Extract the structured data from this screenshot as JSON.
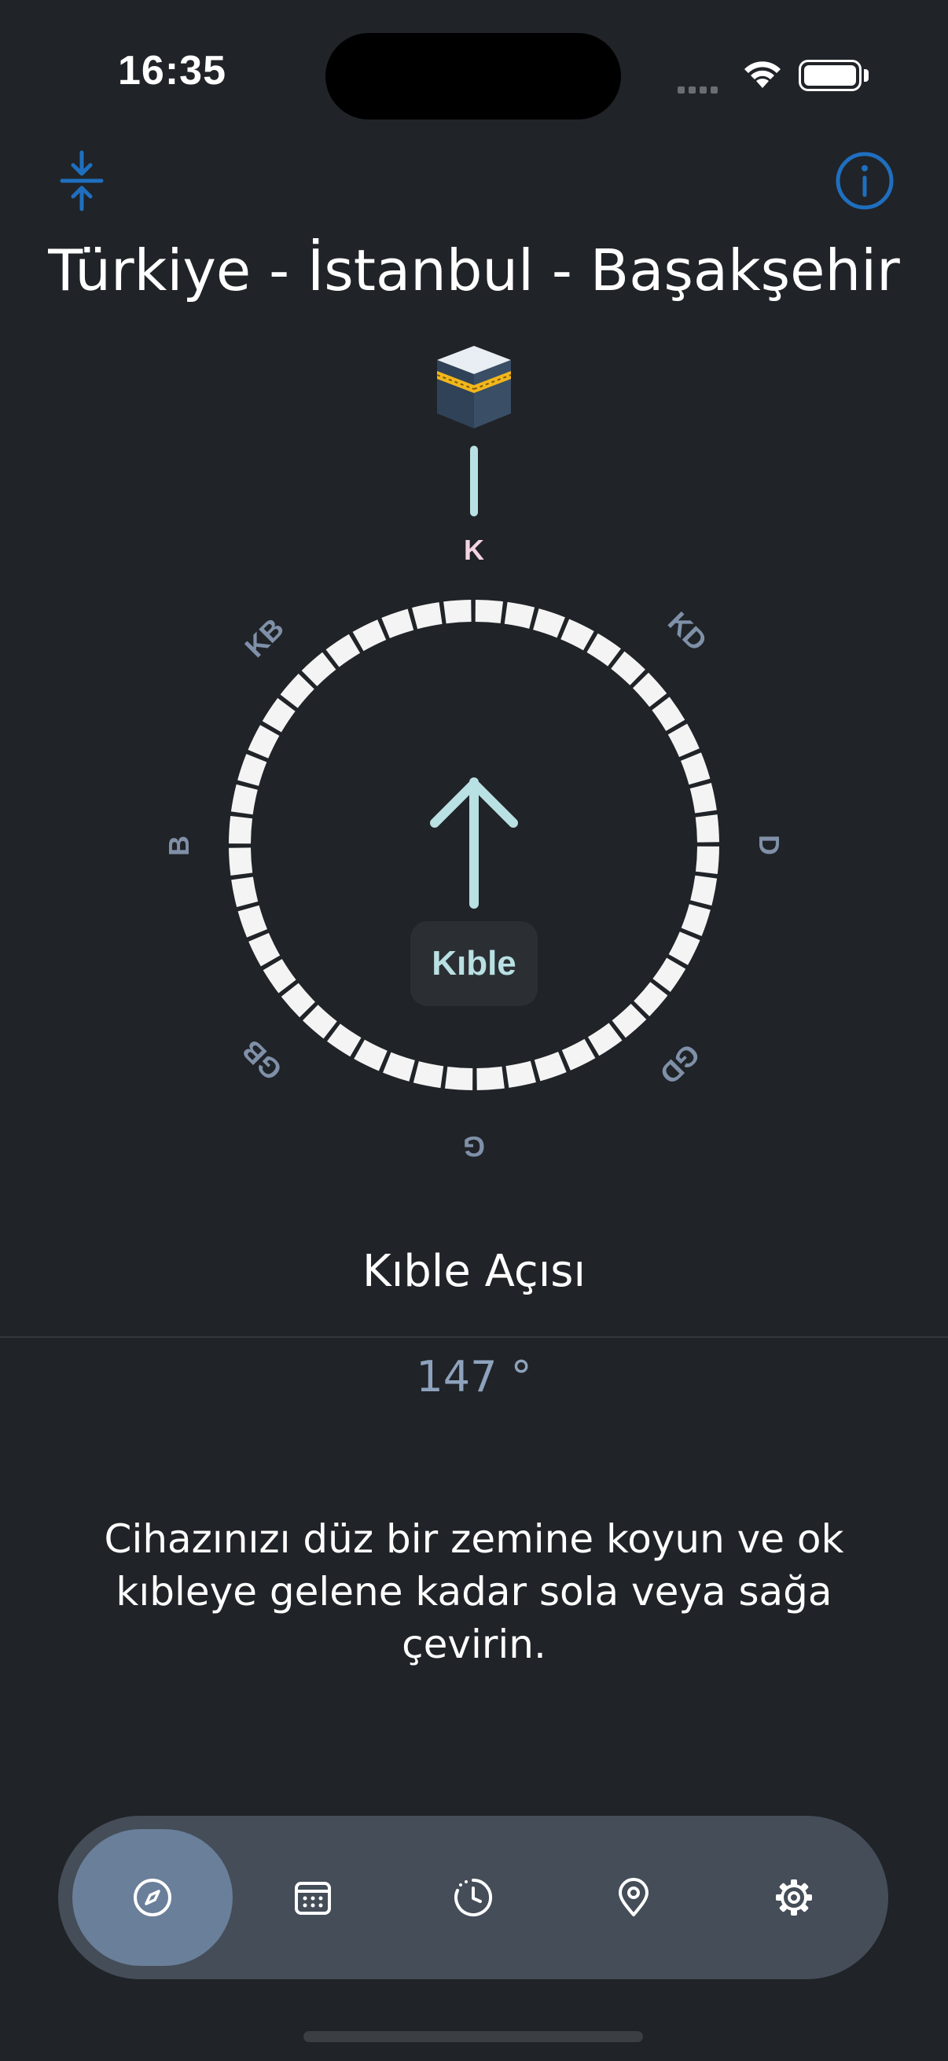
{
  "status_bar": {
    "time": "16:35"
  },
  "header": {
    "left_icon": "compress-vertical-icon",
    "right_icon": "info-icon",
    "location": "Türkiye - İstanbul - Başakşehir",
    "accent_color": "#1f6fbf"
  },
  "compass": {
    "directions": {
      "north": "K",
      "northeast": "KD",
      "east": "D",
      "southeast": "GD",
      "south": "G",
      "southwest": "GB",
      "west": "B",
      "northwest": "KB"
    },
    "qibla_label": "Kıble",
    "kaaba_icon": "kaaba-icon",
    "arrow_color": "#b9e0e2",
    "north_color": "#f4d3e3",
    "direction_color": "#7f90a8"
  },
  "qibla": {
    "title": "Kıble Açısı",
    "angle": "147 °",
    "instruction": "Cihazınızı düz bir zemine koyun ve ok kıbleye gelene kadar sola veya sağa çevirin."
  },
  "tabbar": {
    "tabs": [
      {
        "icon": "compass-icon",
        "active": true
      },
      {
        "icon": "calendar-icon",
        "active": false
      },
      {
        "icon": "clock-history-icon",
        "active": false
      },
      {
        "icon": "location-pin-icon",
        "active": false
      },
      {
        "icon": "settings-gear-icon",
        "active": false
      }
    ]
  }
}
